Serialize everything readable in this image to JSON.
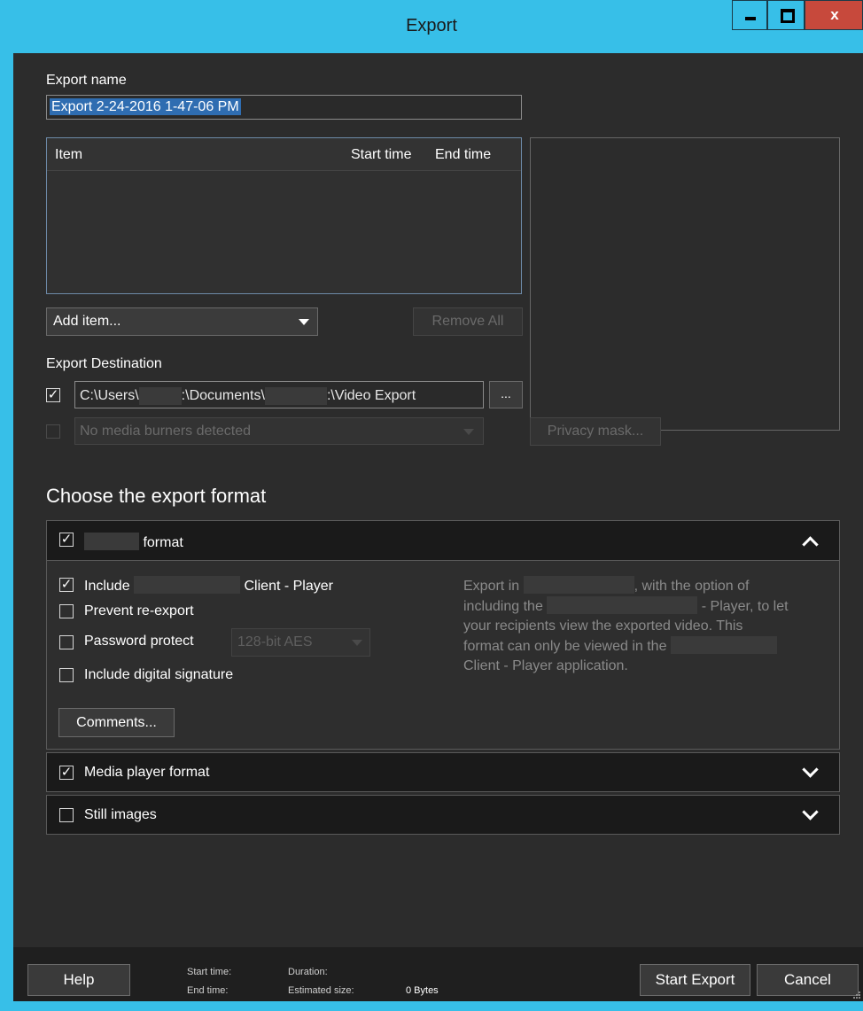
{
  "window": {
    "title": "Export",
    "close_glyph": "x"
  },
  "export_name": {
    "label": "Export name",
    "value": "Export 2-24-2016 1-47-06 PM"
  },
  "items_table": {
    "col_item": "Item",
    "col_start": "Start time",
    "col_end": "End time"
  },
  "add_item": {
    "label": "Add item..."
  },
  "remove_all": {
    "label": "Remove All"
  },
  "destination": {
    "label": "Export Destination",
    "path_part1": "C:\\Users\\",
    "path_part2": ":\\Documents\\",
    "path_part3": ":\\Video Export",
    "browse_label": "...",
    "burner_placeholder": "No media burners detected"
  },
  "privacy_mask": {
    "label": "Privacy mask..."
  },
  "format_heading": "Choose the export format",
  "formats": {
    "native": {
      "title": "format",
      "include_client_pre": "Include",
      "include_client_post": "Client - Player",
      "prevent_reexport": "Prevent re-export",
      "password_protect": "Password protect",
      "encryption": "128-bit AES",
      "digital_signature": "Include digital signature",
      "comments": "Comments...",
      "desc_1": "Export in",
      "desc_2": ", with the option of",
      "desc_3": "including the",
      "desc_4": "- Player, to let",
      "desc_5": "your recipients view the exported video. This",
      "desc_6": "format can only be viewed in the",
      "desc_7": "Client - Player application."
    },
    "media_player": {
      "title": "Media player format"
    },
    "still_images": {
      "title": "Still images"
    }
  },
  "footer": {
    "help": "Help",
    "start_time_label": "Start time:",
    "end_time_label": "End time:",
    "duration_label": "Duration:",
    "estimated_size_label": "Estimated size:",
    "estimated_size_value": "0 Bytes",
    "start_export": "Start Export",
    "cancel": "Cancel"
  },
  "check_glyph": "✓",
  "colors": {
    "accent": "#37bfe8",
    "close": "#c7493c",
    "selection": "#2f6db1"
  }
}
